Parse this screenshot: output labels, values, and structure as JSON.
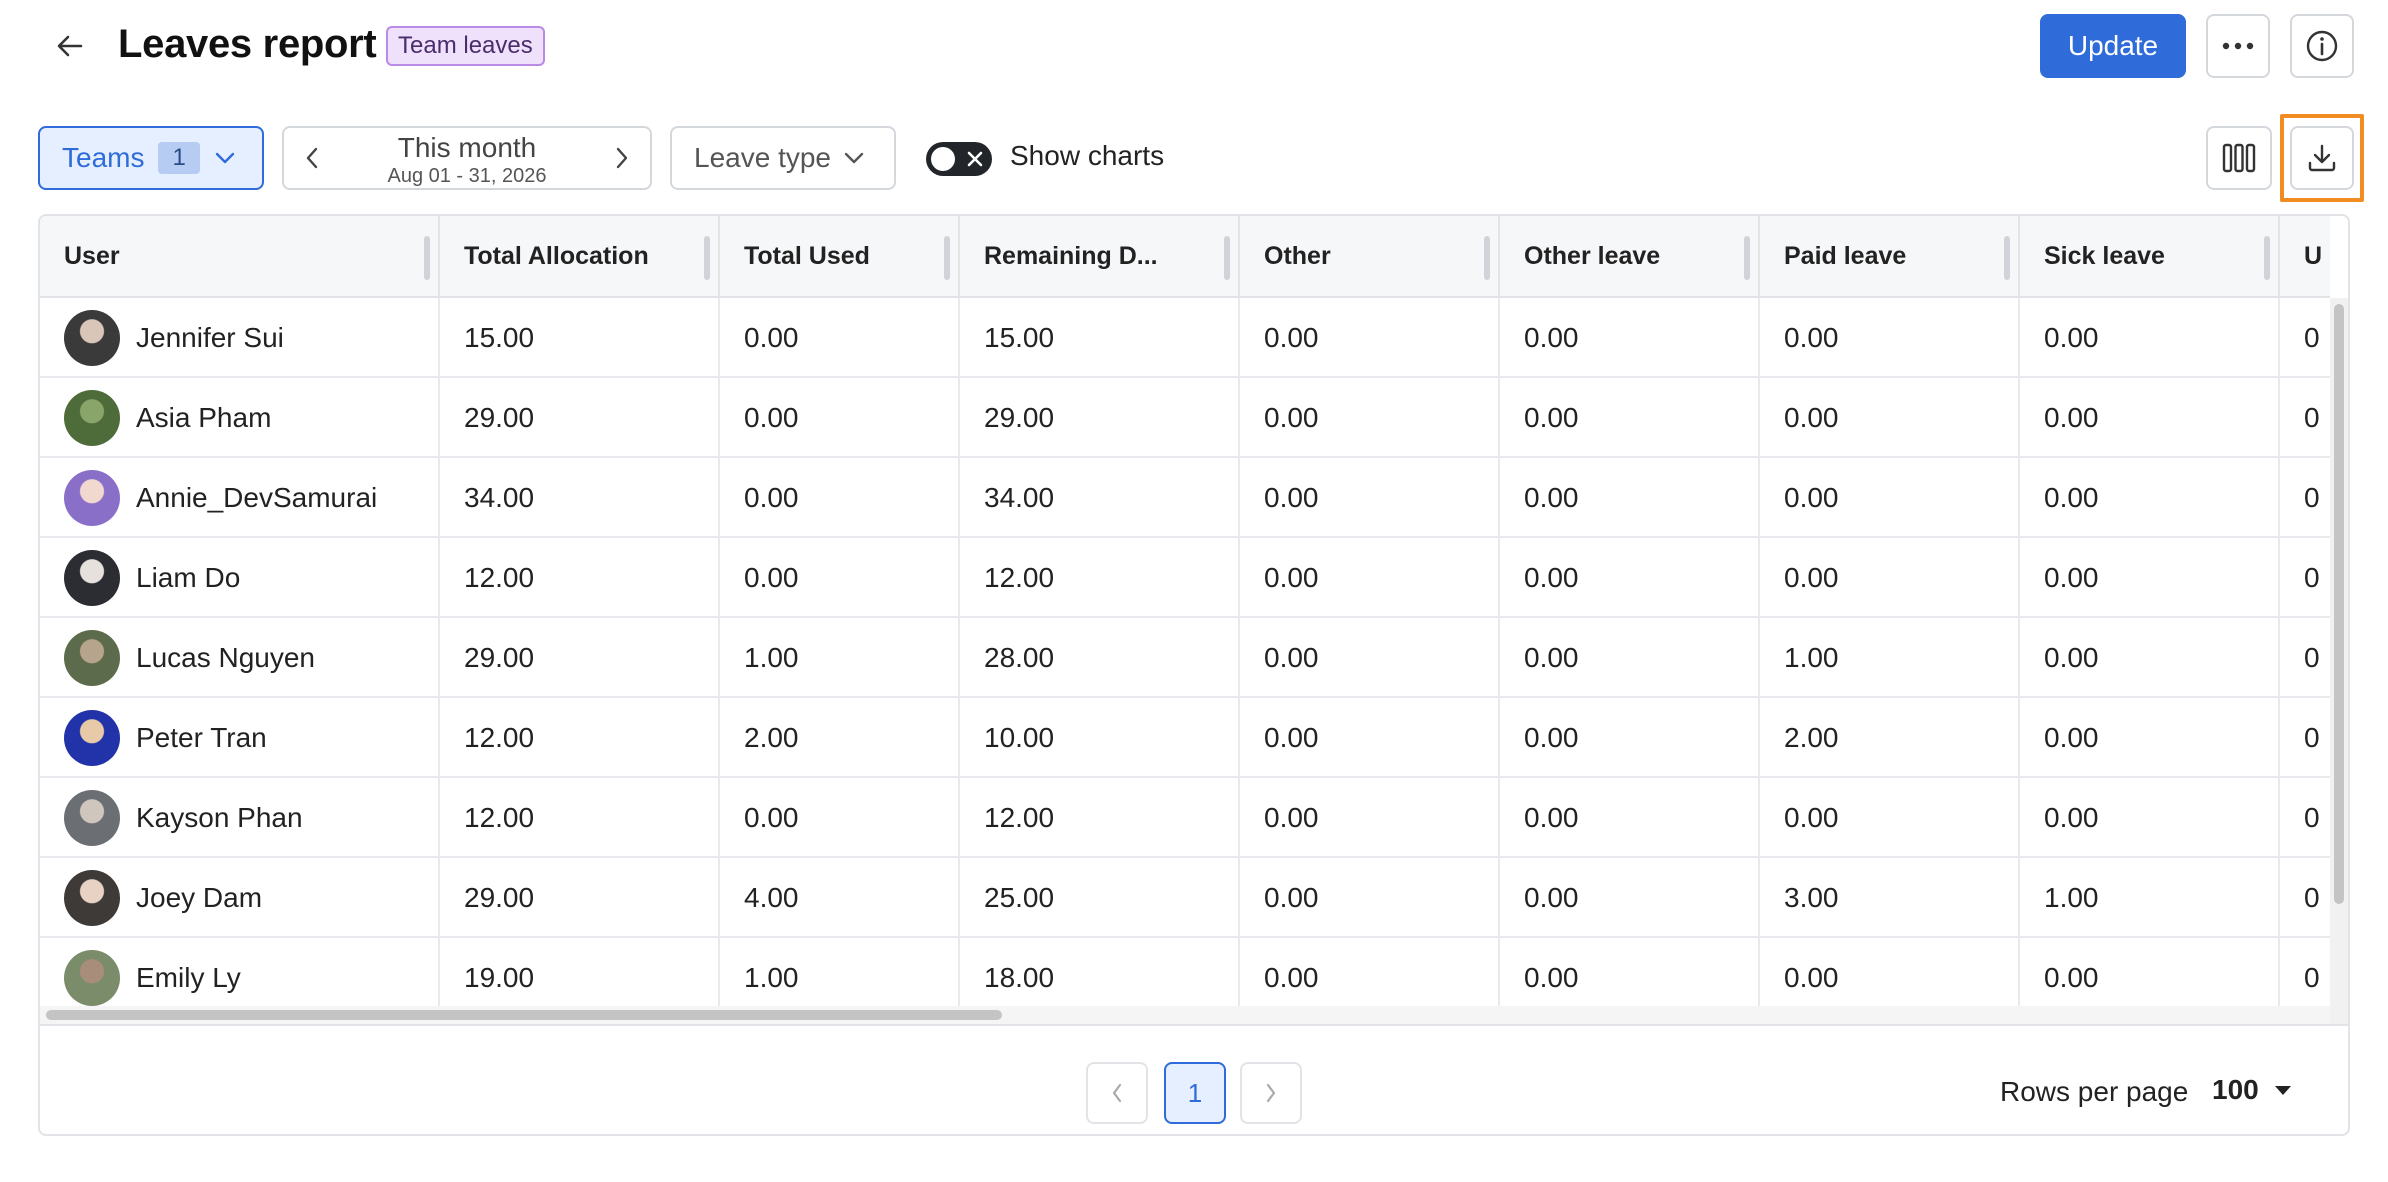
{
  "header": {
    "title": "Leaves report",
    "tag": "Team leaves",
    "update_label": "Update"
  },
  "toolbar": {
    "teams_label": "Teams",
    "teams_count": "1",
    "period_label": "This month",
    "period_range": "Aug 01 - 31, 2026",
    "leave_type_label": "Leave type",
    "show_charts_label": "Show charts",
    "show_charts_on": false
  },
  "table": {
    "columns": [
      "User",
      "Total Allocation",
      "Total Used",
      "Remaining D...",
      "Other",
      "Other leave",
      "Paid leave",
      "Sick leave",
      "U"
    ],
    "rows": [
      {
        "user": "Jennifer Sui",
        "values": [
          "15.00",
          "0.00",
          "15.00",
          "0.00",
          "0.00",
          "0.00",
          "0.00",
          "0"
        ]
      },
      {
        "user": "Asia Pham",
        "values": [
          "29.00",
          "0.00",
          "29.00",
          "0.00",
          "0.00",
          "0.00",
          "0.00",
          "0"
        ]
      },
      {
        "user": "Annie_DevSamurai",
        "values": [
          "34.00",
          "0.00",
          "34.00",
          "0.00",
          "0.00",
          "0.00",
          "0.00",
          "0"
        ]
      },
      {
        "user": "Liam Do",
        "values": [
          "12.00",
          "0.00",
          "12.00",
          "0.00",
          "0.00",
          "0.00",
          "0.00",
          "0"
        ]
      },
      {
        "user": "Lucas Nguyen",
        "values": [
          "29.00",
          "1.00",
          "28.00",
          "0.00",
          "0.00",
          "1.00",
          "0.00",
          "0"
        ]
      },
      {
        "user": "Peter Tran",
        "values": [
          "12.00",
          "2.00",
          "10.00",
          "0.00",
          "0.00",
          "2.00",
          "0.00",
          "0"
        ]
      },
      {
        "user": "Kayson Phan",
        "values": [
          "12.00",
          "0.00",
          "12.00",
          "0.00",
          "0.00",
          "0.00",
          "0.00",
          "0"
        ]
      },
      {
        "user": "Joey Dam",
        "values": [
          "29.00",
          "4.00",
          "25.00",
          "0.00",
          "0.00",
          "3.00",
          "1.00",
          "0"
        ]
      },
      {
        "user": "Emily Ly",
        "values": [
          "19.00",
          "1.00",
          "18.00",
          "0.00",
          "0.00",
          "0.00",
          "0.00",
          "0"
        ]
      }
    ]
  },
  "pagination": {
    "current_page": "1",
    "rows_per_page_label": "Rows per page",
    "rows_per_page_value": "100"
  },
  "colors": {
    "accent": "#2f6bd9",
    "highlight": "#f08c22",
    "tag_bg": "#efe1fb"
  },
  "icons": {
    "back": "arrow-left-icon",
    "more": "more-horizontal-icon",
    "info": "info-icon",
    "columns": "columns-icon",
    "download": "download-icon"
  }
}
